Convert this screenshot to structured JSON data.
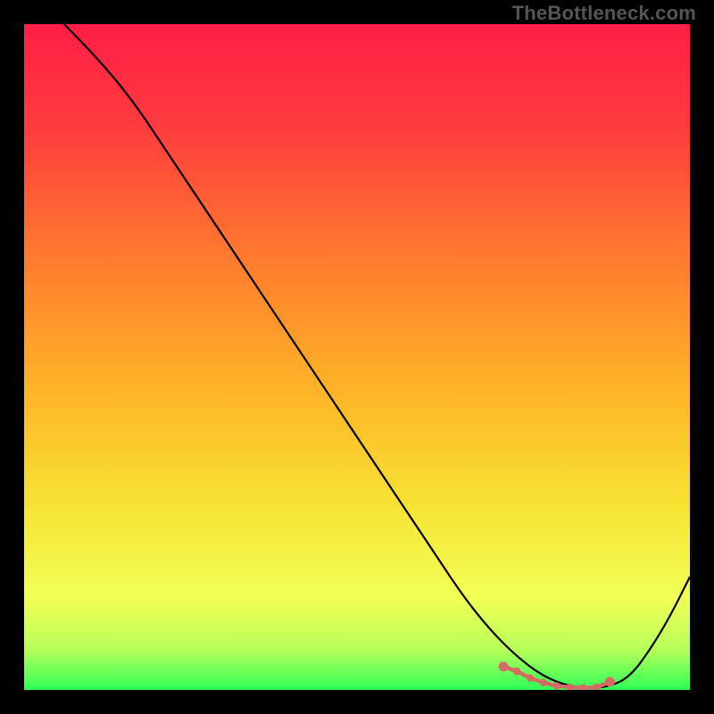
{
  "watermark": "TheBottleneck.com",
  "chart_data": {
    "type": "line",
    "title": "",
    "xlabel": "",
    "ylabel": "",
    "xlim": [
      0,
      100
    ],
    "ylim": [
      0,
      100
    ],
    "series": [
      {
        "name": "bottleneck-curve",
        "x": [
          6,
          10,
          16,
          22,
          28,
          34,
          40,
          46,
          52,
          58,
          62,
          66,
          70,
          74,
          78,
          82,
          85,
          88,
          91,
          94,
          97,
          100
        ],
        "y": [
          100,
          96,
          89,
          80,
          71,
          62,
          53,
          44,
          35,
          26,
          20,
          14,
          9,
          5,
          2,
          0.5,
          0.3,
          0.5,
          2,
          6,
          11,
          17
        ]
      }
    ],
    "highlight_points": {
      "name": "optimal-zone",
      "x": [
        72,
        74,
        76,
        78,
        80,
        82,
        84,
        86,
        88
      ],
      "y": [
        3.5,
        2.8,
        1.8,
        1.1,
        0.6,
        0.4,
        0.3,
        0.4,
        1.2
      ]
    },
    "gradient_stops": [
      {
        "offset": 0.0,
        "color": "#ff1e46"
      },
      {
        "offset": 0.15,
        "color": "#ff3a3e"
      },
      {
        "offset": 0.35,
        "color": "#ff7a2e"
      },
      {
        "offset": 0.55,
        "color": "#ffb427"
      },
      {
        "offset": 0.72,
        "color": "#f7e233"
      },
      {
        "offset": 0.86,
        "color": "#f2ff56"
      },
      {
        "offset": 0.94,
        "color": "#b6ff58"
      },
      {
        "offset": 1.0,
        "color": "#2dff57"
      }
    ]
  }
}
